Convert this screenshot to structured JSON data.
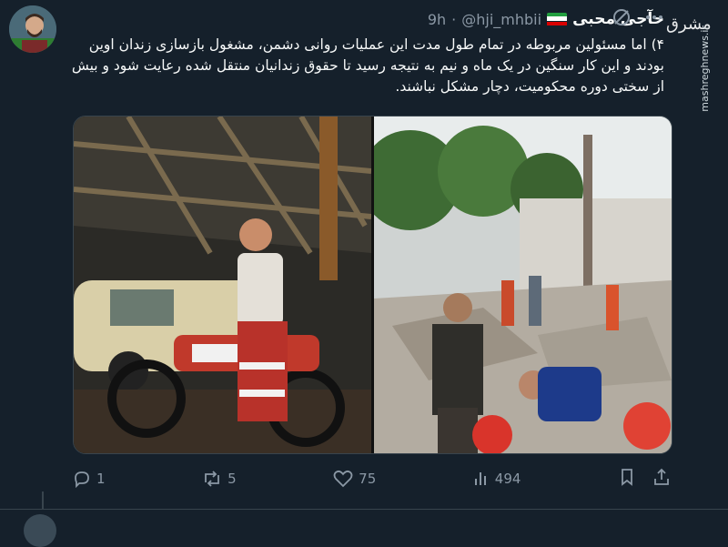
{
  "author": {
    "display_name": "حآجی محبی",
    "handle": "@hji_mhbii",
    "time": "9h"
  },
  "separator": "·",
  "watermark": {
    "logo_text": "مشرق",
    "url": "mashreghnews.ir"
  },
  "tweet": {
    "text": "۴) اما مسئولین مربوطه در تمام طول مدت این عملیات روانی دشمن، مشغول بازسازی زندان اوین بودند و این کار سنگین در یک ماه و نیم به نتیجه رسید تا حقوق زندانیان منتقل شده رعایت شود و بیش از سختی دوره محکومیت، دچار مشکل نباشند."
  },
  "metrics": {
    "replies": "1",
    "reposts": "5",
    "likes": "75",
    "views": "494"
  },
  "icons": {
    "top": [
      "grok-icon",
      "more-icon"
    ],
    "actions": [
      "reply-icon",
      "repost-icon",
      "like-icon",
      "views-icon",
      "bookmark-icon",
      "share-icon"
    ]
  },
  "colors": {
    "background": "#15202b",
    "text": "#f7f9f9",
    "muted": "#8b98a5",
    "border": "#38444d"
  }
}
